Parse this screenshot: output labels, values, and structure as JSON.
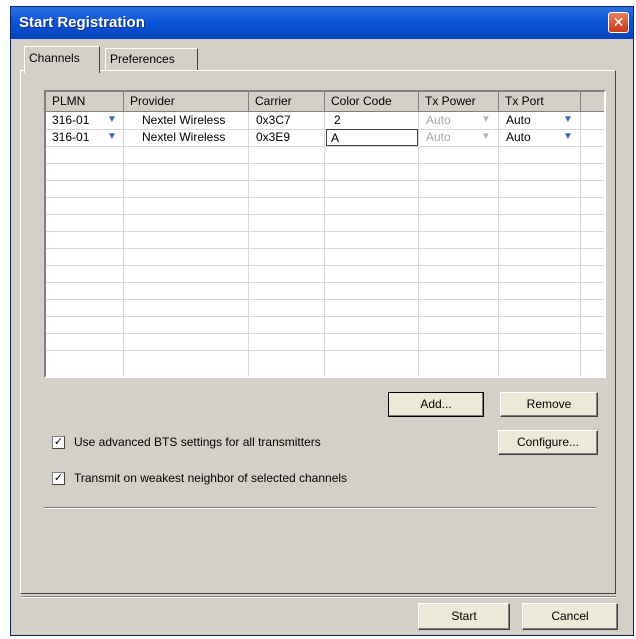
{
  "window": {
    "title": "Start Registration",
    "close_glyph": "✕"
  },
  "tabs": [
    {
      "label": "Channels",
      "active": true
    },
    {
      "label": "Preferences",
      "active": false
    }
  ],
  "grid": {
    "columns": [
      "PLMN",
      "Provider",
      "Carrier",
      "Color Code",
      "Tx Power",
      "Tx Port"
    ],
    "rows": [
      {
        "plmn": "316-01",
        "provider": "Nextel Wireless",
        "carrier": "0x3C7",
        "color_code": "2",
        "tx_power": "Auto",
        "tx_port": "Auto"
      },
      {
        "plmn": "316-01",
        "provider": "Nextel Wireless",
        "carrier": "0x3E9",
        "color_code": "A",
        "tx_power": "Auto",
        "tx_port": "Auto"
      }
    ],
    "dropdown_glyph": "▼"
  },
  "buttons": {
    "add": "Add...",
    "remove": "Remove",
    "configure": "Configure...",
    "start": "Start",
    "cancel": "Cancel"
  },
  "options": {
    "advanced_bts": {
      "label": "Use advanced BTS settings for all transmitters",
      "checked": true
    },
    "weakest_neighbor": {
      "label": "Transmit on weakest neighbor of selected channels",
      "checked": true
    },
    "check_glyph": "✓"
  }
}
